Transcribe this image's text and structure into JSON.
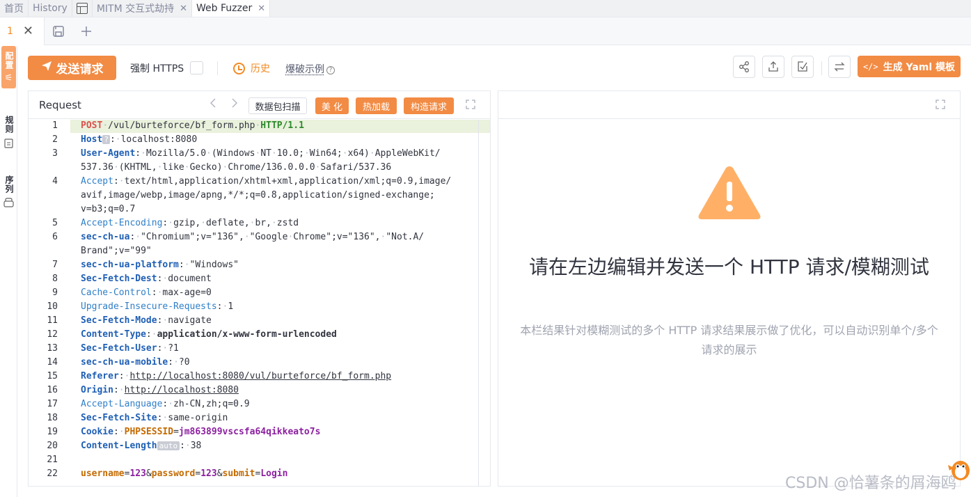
{
  "top_tabs": [
    {
      "label": "首页"
    },
    {
      "label": "History"
    },
    {
      "label": "MITM 交互式劫持",
      "close": "✕"
    },
    {
      "label": "Web Fuzzer",
      "close": "✕"
    }
  ],
  "sub_tab": {
    "number": "1",
    "close": "✕"
  },
  "side_tabs": {
    "config": "配置",
    "rules": "规则",
    "sequence": "序列"
  },
  "toolbar": {
    "send": "发送请求",
    "force_https": "强制 HTTPS",
    "history": "历史",
    "example": "爆破示例",
    "yaml": "生成 Yaml 模板",
    "yaml_code_icon": "</>"
  },
  "request": {
    "title": "Request",
    "scan": "数据包扫描",
    "beautify": "美 化",
    "hotload": "热加载",
    "construct": "构造请求",
    "lines": [
      {
        "n": "1",
        "segs": [
          {
            "c": "k-red",
            "t": "POST"
          },
          {
            "c": "dim",
            "t": "·"
          },
          {
            "c": "",
            "t": "/vul/burteforce/bf_form.php"
          },
          {
            "c": "dim",
            "t": "·"
          },
          {
            "c": "k-green",
            "t": "HTTP/1.1"
          }
        ]
      },
      {
        "n": "2",
        "segs": [
          {
            "c": "k-blue",
            "t": "Host"
          },
          {
            "c": "tagq",
            "t": "?"
          },
          {
            "c": "",
            "t": ":"
          },
          {
            "c": "dim",
            "t": "·"
          },
          {
            "c": "",
            "t": "localhost:8080"
          }
        ]
      },
      {
        "n": "3",
        "segs": [
          {
            "c": "k-blue",
            "t": "User-Agent"
          },
          {
            "c": "",
            "t": ":"
          },
          {
            "c": "dim",
            "t": "·"
          },
          {
            "c": "",
            "t": "Mozilla/5.0"
          },
          {
            "c": "dim",
            "t": "·"
          },
          {
            "c": "",
            "t": "(Windows"
          },
          {
            "c": "dim",
            "t": "·"
          },
          {
            "c": "",
            "t": "NT"
          },
          {
            "c": "dim",
            "t": "·"
          },
          {
            "c": "",
            "t": "10.0;"
          },
          {
            "c": "dim",
            "t": "·"
          },
          {
            "c": "",
            "t": "Win64;"
          },
          {
            "c": "dim",
            "t": "·"
          },
          {
            "c": "",
            "t": "x64)"
          },
          {
            "c": "dim",
            "t": "·"
          },
          {
            "c": "",
            "t": "AppleWebKit/"
          }
        ]
      },
      {
        "n": "",
        "segs": [
          {
            "c": "",
            "t": "537.36"
          },
          {
            "c": "dim",
            "t": "·"
          },
          {
            "c": "",
            "t": "(KHTML,"
          },
          {
            "c": "dim",
            "t": "·"
          },
          {
            "c": "",
            "t": "like"
          },
          {
            "c": "dim",
            "t": "·"
          },
          {
            "c": "",
            "t": "Gecko)"
          },
          {
            "c": "dim",
            "t": "·"
          },
          {
            "c": "",
            "t": "Chrome/136.0.0.0"
          },
          {
            "c": "dim",
            "t": "·"
          },
          {
            "c": "",
            "t": "Safari/537.36"
          }
        ]
      },
      {
        "n": "4",
        "segs": [
          {
            "c": "k-lblue",
            "t": "Accept"
          },
          {
            "c": "",
            "t": ":"
          },
          {
            "c": "dim",
            "t": "·"
          },
          {
            "c": "",
            "t": "text/html,application/xhtml+xml,application/xml;q=0.9,image/"
          }
        ]
      },
      {
        "n": "",
        "segs": [
          {
            "c": "",
            "t": "avif,image/webp,image/apng,*/*;q=0.8,application/signed-exchange;"
          }
        ]
      },
      {
        "n": "",
        "segs": [
          {
            "c": "",
            "t": "v=b3;q=0.7"
          }
        ]
      },
      {
        "n": "5",
        "segs": [
          {
            "c": "k-lblue",
            "t": "Accept-Encoding"
          },
          {
            "c": "",
            "t": ":"
          },
          {
            "c": "dim",
            "t": "·"
          },
          {
            "c": "",
            "t": "gzip,"
          },
          {
            "c": "dim",
            "t": "·"
          },
          {
            "c": "",
            "t": "deflate,"
          },
          {
            "c": "dim",
            "t": "·"
          },
          {
            "c": "",
            "t": "br,"
          },
          {
            "c": "dim",
            "t": "·"
          },
          {
            "c": "",
            "t": "zstd"
          }
        ]
      },
      {
        "n": "6",
        "segs": [
          {
            "c": "k-blue",
            "t": "sec-ch-ua"
          },
          {
            "c": "",
            "t": ":"
          },
          {
            "c": "dim",
            "t": "·"
          },
          {
            "c": "",
            "t": "\"Chromium\";v=\"136\","
          },
          {
            "c": "dim",
            "t": "·"
          },
          {
            "c": "",
            "t": "\"Google"
          },
          {
            "c": "dim",
            "t": "·"
          },
          {
            "c": "",
            "t": "Chrome\";v=\"136\","
          },
          {
            "c": "dim",
            "t": "·"
          },
          {
            "c": "",
            "t": "\"Not.A/"
          }
        ]
      },
      {
        "n": "",
        "segs": [
          {
            "c": "",
            "t": "Brand\";v=\"99\""
          }
        ]
      },
      {
        "n": "7",
        "segs": [
          {
            "c": "k-blue",
            "t": "sec-ch-ua-platform"
          },
          {
            "c": "",
            "t": ":"
          },
          {
            "c": "dim",
            "t": "·"
          },
          {
            "c": "",
            "t": "\"Windows\""
          }
        ]
      },
      {
        "n": "8",
        "segs": [
          {
            "c": "k-blue",
            "t": "Sec-Fetch-Dest"
          },
          {
            "c": "",
            "t": ":"
          },
          {
            "c": "dim",
            "t": "·"
          },
          {
            "c": "",
            "t": "document"
          }
        ]
      },
      {
        "n": "9",
        "segs": [
          {
            "c": "k-lblue",
            "t": "Cache-Control"
          },
          {
            "c": "",
            "t": ":"
          },
          {
            "c": "dim",
            "t": "·"
          },
          {
            "c": "",
            "t": "max-age=0"
          }
        ]
      },
      {
        "n": "10",
        "segs": [
          {
            "c": "k-lblue",
            "t": "Upgrade-Insecure-Requests"
          },
          {
            "c": "",
            "t": ":"
          },
          {
            "c": "dim",
            "t": "·"
          },
          {
            "c": "",
            "t": "1"
          }
        ]
      },
      {
        "n": "11",
        "segs": [
          {
            "c": "k-blue",
            "t": "Sec-Fetch-Mode"
          },
          {
            "c": "",
            "t": ":"
          },
          {
            "c": "dim",
            "t": "·"
          },
          {
            "c": "",
            "t": "navigate"
          }
        ]
      },
      {
        "n": "12",
        "segs": [
          {
            "c": "k-blue",
            "t": "Content-Type"
          },
          {
            "c": "",
            "t": ":"
          },
          {
            "c": "dim",
            "t": "·"
          },
          {
            "c": "k-plain-bold",
            "t": "application/x-www-form-urlencoded"
          }
        ]
      },
      {
        "n": "13",
        "segs": [
          {
            "c": "k-blue",
            "t": "Sec-Fetch-User"
          },
          {
            "c": "",
            "t": ":"
          },
          {
            "c": "dim",
            "t": "·"
          },
          {
            "c": "",
            "t": "?1"
          }
        ]
      },
      {
        "n": "14",
        "segs": [
          {
            "c": "k-blue",
            "t": "sec-ch-ua-mobile"
          },
          {
            "c": "",
            "t": ":"
          },
          {
            "c": "dim",
            "t": "·"
          },
          {
            "c": "",
            "t": "?0"
          }
        ]
      },
      {
        "n": "15",
        "segs": [
          {
            "c": "k-blue",
            "t": "Referer"
          },
          {
            "c": "",
            "t": ":"
          },
          {
            "c": "dim",
            "t": "·"
          },
          {
            "c": "uline",
            "t": "http://localhost:8080/vul/burteforce/bf_form.php"
          }
        ]
      },
      {
        "n": "16",
        "segs": [
          {
            "c": "k-blue",
            "t": "Origin"
          },
          {
            "c": "",
            "t": ":"
          },
          {
            "c": "dim",
            "t": "·"
          },
          {
            "c": "uline",
            "t": "http://localhost:8080"
          }
        ]
      },
      {
        "n": "17",
        "segs": [
          {
            "c": "k-lblue",
            "t": "Accept-Language"
          },
          {
            "c": "",
            "t": ":"
          },
          {
            "c": "dim",
            "t": "·"
          },
          {
            "c": "",
            "t": "zh-CN,zh;q=0.9"
          }
        ]
      },
      {
        "n": "18",
        "segs": [
          {
            "c": "k-blue",
            "t": "Sec-Fetch-Site"
          },
          {
            "c": "",
            "t": ":"
          },
          {
            "c": "dim",
            "t": "·"
          },
          {
            "c": "",
            "t": "same-origin"
          }
        ]
      },
      {
        "n": "19",
        "segs": [
          {
            "c": "k-blue",
            "t": "Cookie"
          },
          {
            "c": "",
            "t": ":"
          },
          {
            "c": "dim",
            "t": "·"
          },
          {
            "c": "k-orange",
            "t": "PHPSESSID"
          },
          {
            "c": "",
            "t": "="
          },
          {
            "c": "k-purple",
            "t": "jm863899vscsfa64qikkeato7s"
          }
        ]
      },
      {
        "n": "20",
        "segs": [
          {
            "c": "k-blue",
            "t": "Content-Length"
          },
          {
            "c": "tagauto",
            "t": "auto"
          },
          {
            "c": "",
            "t": ":"
          },
          {
            "c": "dim",
            "t": "·"
          },
          {
            "c": "",
            "t": "38"
          }
        ]
      },
      {
        "n": "21",
        "segs": []
      },
      {
        "n": "22",
        "segs": [
          {
            "c": "k-orange",
            "t": "username"
          },
          {
            "c": "",
            "t": "="
          },
          {
            "c": "k-purple",
            "t": "123"
          },
          {
            "c": "",
            "t": "&"
          },
          {
            "c": "k-orange",
            "t": "password"
          },
          {
            "c": "",
            "t": "="
          },
          {
            "c": "k-purple",
            "t": "123"
          },
          {
            "c": "",
            "t": "&"
          },
          {
            "c": "k-orange",
            "t": "submit"
          },
          {
            "c": "",
            "t": "="
          },
          {
            "c": "k-purple",
            "t": "Login"
          }
        ]
      }
    ]
  },
  "response": {
    "empty_title": "请在左边编辑并发送一个 HTTP 请求/模糊测试",
    "empty_desc": "本栏结果针对模糊测试的多个 HTTP 请求结果展示做了优化，可以自动识别单个/多个请求的展示"
  },
  "watermark": "CSDN @恰薯条的屑海鸥",
  "colors": {
    "accent": "#f28b44",
    "warning": "#ffb066"
  }
}
